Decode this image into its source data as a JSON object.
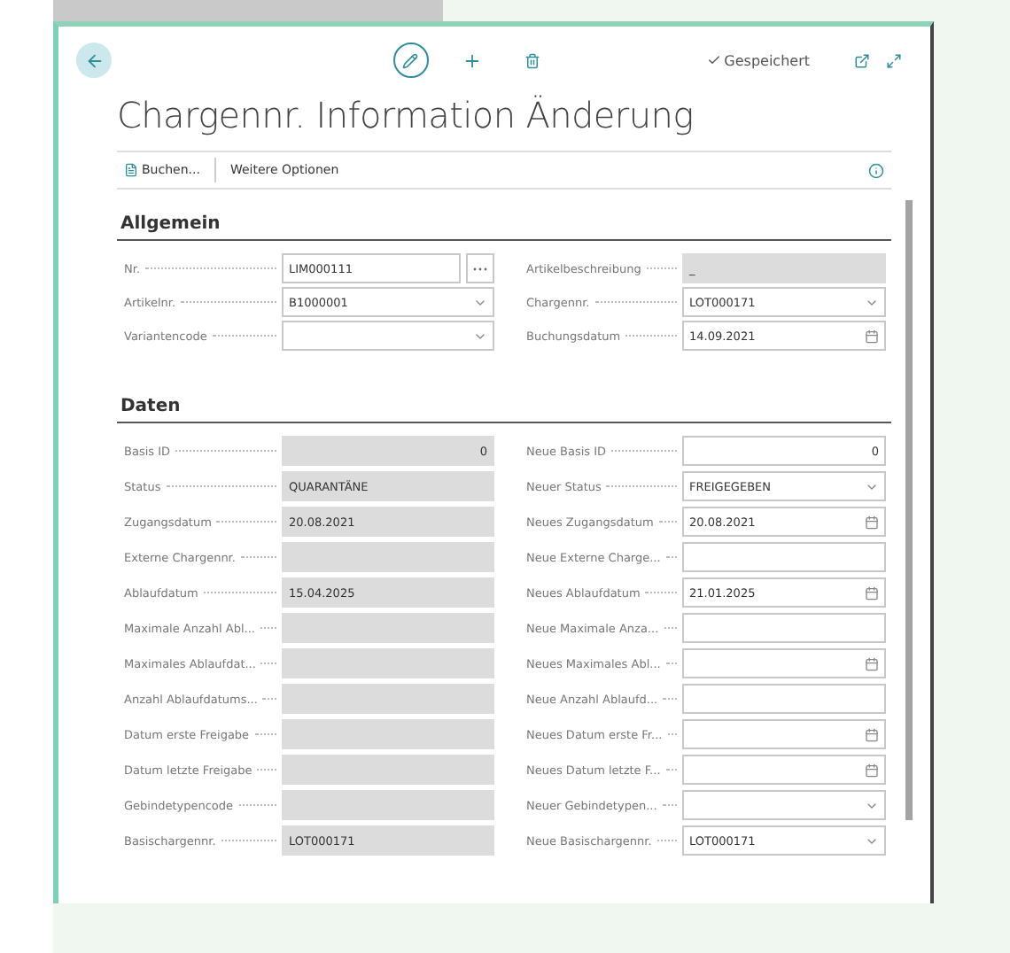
{
  "header": {
    "saved_label": "Gespeichert"
  },
  "title": "Chargennr. Information Änderung",
  "toolbar": [
    {
      "label": "Buchen...",
      "kind": "post"
    },
    {
      "label": "Weitere Optionen",
      "kind": "plain"
    }
  ],
  "sections": [
    {
      "title": "Allgemein",
      "left": [
        {
          "label": "Nr.",
          "value": "LIM000111",
          "kind": "lookup",
          "editable": true
        },
        {
          "label": "Artikelnr.",
          "value": "B1000001",
          "kind": "dropdown",
          "editable": true
        },
        {
          "label": "Variantencode",
          "kind": "dropdown",
          "editable": true
        }
      ],
      "right": [
        {
          "label": "Artikelbeschreibung",
          "value": "_",
          "kind": "text",
          "editable": false
        },
        {
          "label": "Chargennr.",
          "value": "LOT000171",
          "kind": "dropdown",
          "editable": true
        },
        {
          "label": "Buchungsdatum",
          "value": "14.09.2021",
          "kind": "date",
          "editable": true
        }
      ]
    },
    {
      "title": "Daten",
      "left": [
        {
          "label": "Basis ID",
          "value": "0",
          "kind": "number",
          "editable": false
        },
        {
          "label": "Status",
          "value": "QUARANTÄNE",
          "kind": "text",
          "editable": false
        },
        {
          "label": "Zugangsdatum",
          "value": "20.08.2021",
          "kind": "text",
          "editable": false
        },
        {
          "label": "Externe Chargennr.",
          "kind": "text",
          "editable": false
        },
        {
          "label": "Ablaufdatum",
          "value": "15.04.2025",
          "kind": "text",
          "editable": false
        },
        {
          "label": "Maximale Anzahl Abl...",
          "kind": "text",
          "editable": false
        },
        {
          "label": "Maximales Ablaufdat...",
          "kind": "text",
          "editable": false
        },
        {
          "label": "Anzahl Ablaufdatums...",
          "kind": "text",
          "editable": false
        },
        {
          "label": "Datum erste Freigabe",
          "kind": "text",
          "editable": false
        },
        {
          "label": "Datum letzte Freigabe",
          "kind": "text",
          "editable": false
        },
        {
          "label": "Gebindetypencode",
          "kind": "text",
          "editable": false
        },
        {
          "label": "Basischargennr.",
          "value": "LOT000171",
          "kind": "text",
          "editable": false
        }
      ],
      "right": [
        {
          "label": "Neue Basis ID",
          "value": "0",
          "kind": "number",
          "editable": true
        },
        {
          "label": "Neuer Status",
          "value": "FREIGEGEBEN",
          "kind": "dropdown",
          "editable": true
        },
        {
          "label": "Neues Zugangsdatum",
          "value": "20.08.2021",
          "kind": "date",
          "editable": true
        },
        {
          "label": "Neue Externe Charge...",
          "kind": "text",
          "editable": true
        },
        {
          "label": "Neues Ablaufdatum",
          "value": "21.01.2025",
          "kind": "date",
          "editable": true
        },
        {
          "label": "Neue Maximale Anza...",
          "kind": "text",
          "editable": true
        },
        {
          "label": "Neues Maximales Abl...",
          "kind": "date",
          "editable": true
        },
        {
          "label": "Neue Anzahl Ablaufd...",
          "kind": "text",
          "editable": true
        },
        {
          "label": "Neues Datum erste Fr...",
          "kind": "date",
          "editable": true
        },
        {
          "label": "Neues Datum letzte F...",
          "kind": "date",
          "editable": true
        },
        {
          "label": "Neuer Gebindetypen...",
          "kind": "dropdown",
          "editable": true
        },
        {
          "label": "Neue Basischargennr.",
          "value": "LOT000171",
          "kind": "dropdown",
          "editable": true
        }
      ]
    }
  ]
}
